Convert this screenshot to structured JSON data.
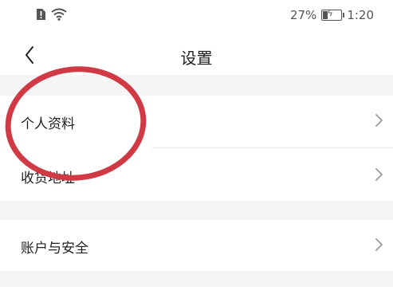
{
  "status_bar": {
    "battery_percent": "27%",
    "time": "1:20",
    "battery_level": 0.27,
    "icons": [
      "sim-alert-icon",
      "wifi-icon",
      "battery-icon"
    ]
  },
  "header": {
    "title": "设置",
    "back_icon": "chevron-left-icon"
  },
  "settings": {
    "items": [
      {
        "label": "个人资料"
      },
      {
        "label": "收货地址"
      },
      {
        "label": "账户与安全"
      }
    ]
  },
  "colors": {
    "annotation_circle": "#d03a45",
    "section_gap": "#f5f5f5",
    "chevron": "#9a9a9a"
  }
}
